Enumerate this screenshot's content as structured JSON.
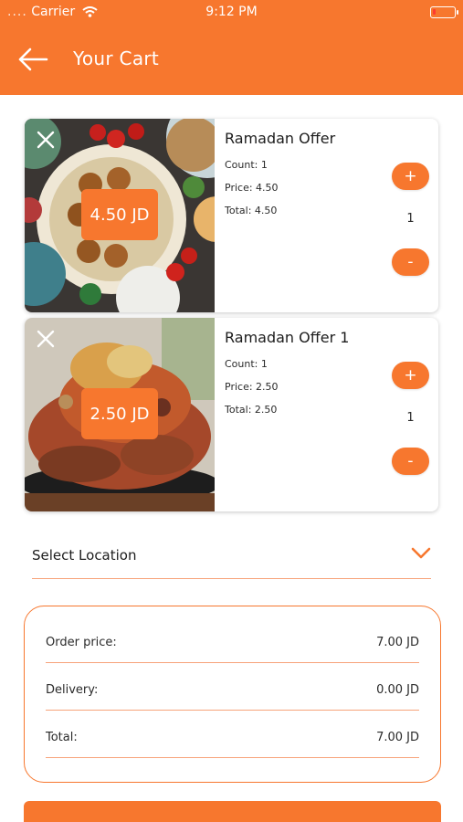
{
  "status_bar": {
    "carrier": "Carrier",
    "time": "9:12 PM"
  },
  "header": {
    "title": "Your Cart",
    "back_icon": "arrow-left-icon"
  },
  "cart_items": [
    {
      "name": "Ramadan Offer",
      "count_line": "Count: 1",
      "price_line": "Price: 4.50",
      "total_line": "Total: 4.50",
      "badge": "4.50 JD",
      "quantity": "1",
      "plus": "+",
      "minus": "-"
    },
    {
      "name": "Ramadan Offer 1",
      "count_line": "Count: 1",
      "price_line": "Price: 2.50",
      "total_line": "Total: 2.50",
      "badge": "2.50 JD",
      "quantity": "1",
      "plus": "+",
      "minus": "-"
    }
  ],
  "location": {
    "label": "Select Location"
  },
  "summary": {
    "order_price_label": "Order price:",
    "order_price_value": "7.00 JD",
    "delivery_label": "Delivery:",
    "delivery_value": "0.00 JD",
    "total_label": "Total:",
    "total_value": "7.00 JD"
  },
  "colors": {
    "accent": "#f7772e",
    "divider": "#f7a37a"
  }
}
